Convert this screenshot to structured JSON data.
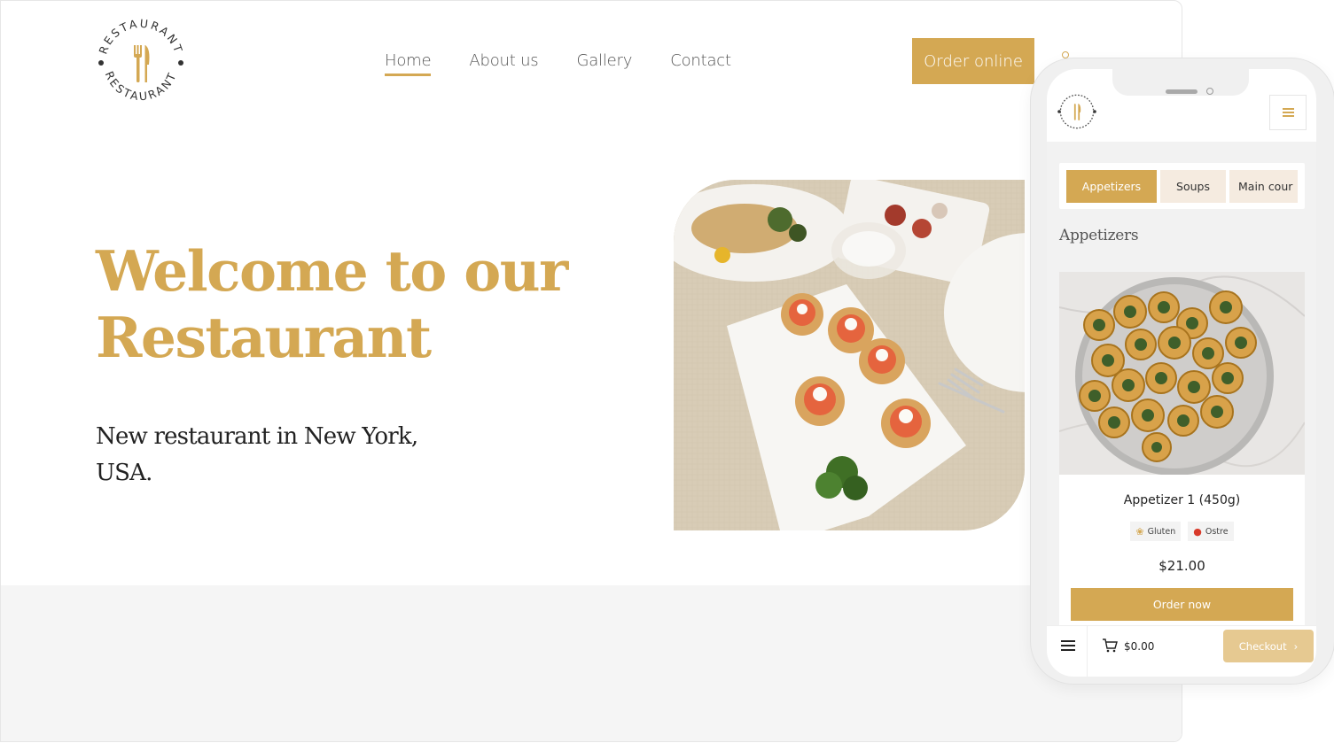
{
  "brand": {
    "logo_text_top": "RESTAURANT",
    "logo_text_bottom": "RESTAURANT",
    "accent_color": "#d4a853"
  },
  "nav": {
    "items": [
      {
        "label": "Home",
        "active": true
      },
      {
        "label": "About us",
        "active": false
      },
      {
        "label": "Gallery",
        "active": false
      },
      {
        "label": "Contact",
        "active": false
      }
    ],
    "cta_label": "Order online"
  },
  "hero": {
    "title_line1": "Welcome to our",
    "title_line2": "Restaurant",
    "subtitle_line1": "New restaurant in New York,",
    "subtitle_line2": "USA."
  },
  "mobile": {
    "menu_icon": "hamburger-icon",
    "tabs": [
      {
        "label": "Appetizers",
        "active": true
      },
      {
        "label": "Soups",
        "active": false
      },
      {
        "label": "Main cour",
        "active": false
      }
    ],
    "section_title": "Appetizers",
    "product": {
      "name": "Appetizer 1 (450g)",
      "tags": [
        {
          "icon": "wheat-icon",
          "label": "Gluten"
        },
        {
          "icon": "chili-icon",
          "label": "Ostre"
        }
      ],
      "price": "$21.00",
      "order_label": "Order now"
    },
    "bottom_bar": {
      "cart_total": "$0.00",
      "checkout_label": "Checkout"
    }
  }
}
